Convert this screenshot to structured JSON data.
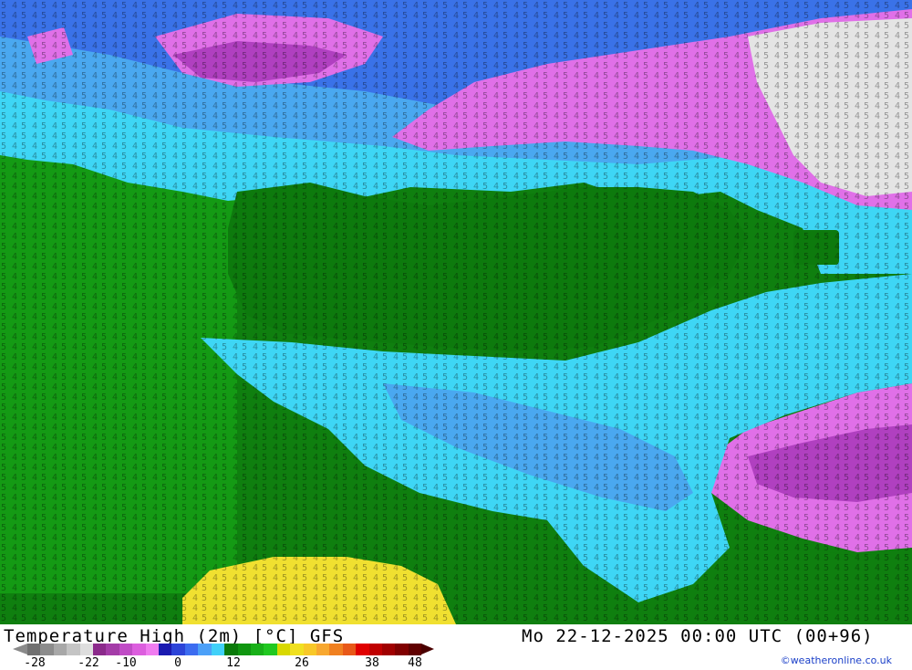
{
  "title": "Temperature High (2m) [°C] GFS",
  "datetime": "Mo 22-12-2025 00:00 UTC (00+96)",
  "credit": "©weatheronline.co.uk",
  "legend": {
    "ticks": [
      "-28",
      "-22",
      "-10",
      "0",
      "12",
      "26",
      "38",
      "48"
    ],
    "colors": [
      "#707070",
      "#8c8c8c",
      "#a8a8a8",
      "#c4c4c4",
      "#dedede",
      "#8b2a8b",
      "#a43ca8",
      "#c04cc6",
      "#dc5ede",
      "#f07cf0",
      "#1a1ab0",
      "#2c44d8",
      "#3c6cf0",
      "#4ca0f8",
      "#40d0f8",
      "#0a7a0a",
      "#109610",
      "#18b018",
      "#20c820",
      "#d8d800",
      "#f0e020",
      "#f8c828",
      "#f8a830",
      "#f08020",
      "#e85818",
      "#e00000",
      "#c00000",
      "#a00000",
      "#800000",
      "#600000"
    ]
  },
  "map": {
    "palette": {
      "ocean_deep": "#0f6c0f",
      "land_green": "#0d7a0d",
      "land_green_light": "#139213",
      "cold_cyan": "#3ed6f5",
      "cold_blue": "#4aa8f0",
      "cold_blue_dark": "#3a72e8",
      "freezing_magenta": "#e070e8",
      "freezing_purple": "#b040c0",
      "snow_white": "#e4e4e4",
      "warm_yellow": "#f0e030"
    }
  }
}
